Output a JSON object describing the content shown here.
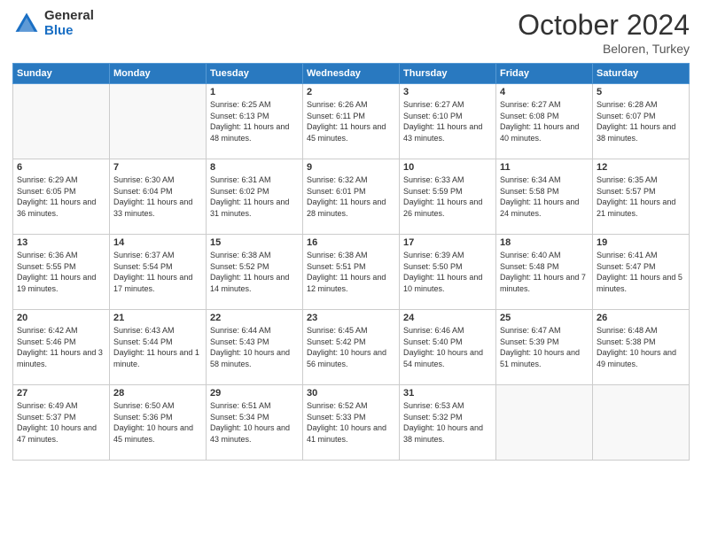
{
  "header": {
    "logo_general": "General",
    "logo_blue": "Blue",
    "month_title": "October 2024",
    "subtitle": "Beloren, Turkey"
  },
  "weekdays": [
    "Sunday",
    "Monday",
    "Tuesday",
    "Wednesday",
    "Thursday",
    "Friday",
    "Saturday"
  ],
  "weeks": [
    [
      {
        "day": "",
        "sunrise": "",
        "sunset": "",
        "daylight": ""
      },
      {
        "day": "",
        "sunrise": "",
        "sunset": "",
        "daylight": ""
      },
      {
        "day": "1",
        "sunrise": "Sunrise: 6:25 AM",
        "sunset": "Sunset: 6:13 PM",
        "daylight": "Daylight: 11 hours and 48 minutes."
      },
      {
        "day": "2",
        "sunrise": "Sunrise: 6:26 AM",
        "sunset": "Sunset: 6:11 PM",
        "daylight": "Daylight: 11 hours and 45 minutes."
      },
      {
        "day": "3",
        "sunrise": "Sunrise: 6:27 AM",
        "sunset": "Sunset: 6:10 PM",
        "daylight": "Daylight: 11 hours and 43 minutes."
      },
      {
        "day": "4",
        "sunrise": "Sunrise: 6:27 AM",
        "sunset": "Sunset: 6:08 PM",
        "daylight": "Daylight: 11 hours and 40 minutes."
      },
      {
        "day": "5",
        "sunrise": "Sunrise: 6:28 AM",
        "sunset": "Sunset: 6:07 PM",
        "daylight": "Daylight: 11 hours and 38 minutes."
      }
    ],
    [
      {
        "day": "6",
        "sunrise": "Sunrise: 6:29 AM",
        "sunset": "Sunset: 6:05 PM",
        "daylight": "Daylight: 11 hours and 36 minutes."
      },
      {
        "day": "7",
        "sunrise": "Sunrise: 6:30 AM",
        "sunset": "Sunset: 6:04 PM",
        "daylight": "Daylight: 11 hours and 33 minutes."
      },
      {
        "day": "8",
        "sunrise": "Sunrise: 6:31 AM",
        "sunset": "Sunset: 6:02 PM",
        "daylight": "Daylight: 11 hours and 31 minutes."
      },
      {
        "day": "9",
        "sunrise": "Sunrise: 6:32 AM",
        "sunset": "Sunset: 6:01 PM",
        "daylight": "Daylight: 11 hours and 28 minutes."
      },
      {
        "day": "10",
        "sunrise": "Sunrise: 6:33 AM",
        "sunset": "Sunset: 5:59 PM",
        "daylight": "Daylight: 11 hours and 26 minutes."
      },
      {
        "day": "11",
        "sunrise": "Sunrise: 6:34 AM",
        "sunset": "Sunset: 5:58 PM",
        "daylight": "Daylight: 11 hours and 24 minutes."
      },
      {
        "day": "12",
        "sunrise": "Sunrise: 6:35 AM",
        "sunset": "Sunset: 5:57 PM",
        "daylight": "Daylight: 11 hours and 21 minutes."
      }
    ],
    [
      {
        "day": "13",
        "sunrise": "Sunrise: 6:36 AM",
        "sunset": "Sunset: 5:55 PM",
        "daylight": "Daylight: 11 hours and 19 minutes."
      },
      {
        "day": "14",
        "sunrise": "Sunrise: 6:37 AM",
        "sunset": "Sunset: 5:54 PM",
        "daylight": "Daylight: 11 hours and 17 minutes."
      },
      {
        "day": "15",
        "sunrise": "Sunrise: 6:38 AM",
        "sunset": "Sunset: 5:52 PM",
        "daylight": "Daylight: 11 hours and 14 minutes."
      },
      {
        "day": "16",
        "sunrise": "Sunrise: 6:38 AM",
        "sunset": "Sunset: 5:51 PM",
        "daylight": "Daylight: 11 hours and 12 minutes."
      },
      {
        "day": "17",
        "sunrise": "Sunrise: 6:39 AM",
        "sunset": "Sunset: 5:50 PM",
        "daylight": "Daylight: 11 hours and 10 minutes."
      },
      {
        "day": "18",
        "sunrise": "Sunrise: 6:40 AM",
        "sunset": "Sunset: 5:48 PM",
        "daylight": "Daylight: 11 hours and 7 minutes."
      },
      {
        "day": "19",
        "sunrise": "Sunrise: 6:41 AM",
        "sunset": "Sunset: 5:47 PM",
        "daylight": "Daylight: 11 hours and 5 minutes."
      }
    ],
    [
      {
        "day": "20",
        "sunrise": "Sunrise: 6:42 AM",
        "sunset": "Sunset: 5:46 PM",
        "daylight": "Daylight: 11 hours and 3 minutes."
      },
      {
        "day": "21",
        "sunrise": "Sunrise: 6:43 AM",
        "sunset": "Sunset: 5:44 PM",
        "daylight": "Daylight: 11 hours and 1 minute."
      },
      {
        "day": "22",
        "sunrise": "Sunrise: 6:44 AM",
        "sunset": "Sunset: 5:43 PM",
        "daylight": "Daylight: 10 hours and 58 minutes."
      },
      {
        "day": "23",
        "sunrise": "Sunrise: 6:45 AM",
        "sunset": "Sunset: 5:42 PM",
        "daylight": "Daylight: 10 hours and 56 minutes."
      },
      {
        "day": "24",
        "sunrise": "Sunrise: 6:46 AM",
        "sunset": "Sunset: 5:40 PM",
        "daylight": "Daylight: 10 hours and 54 minutes."
      },
      {
        "day": "25",
        "sunrise": "Sunrise: 6:47 AM",
        "sunset": "Sunset: 5:39 PM",
        "daylight": "Daylight: 10 hours and 51 minutes."
      },
      {
        "day": "26",
        "sunrise": "Sunrise: 6:48 AM",
        "sunset": "Sunset: 5:38 PM",
        "daylight": "Daylight: 10 hours and 49 minutes."
      }
    ],
    [
      {
        "day": "27",
        "sunrise": "Sunrise: 6:49 AM",
        "sunset": "Sunset: 5:37 PM",
        "daylight": "Daylight: 10 hours and 47 minutes."
      },
      {
        "day": "28",
        "sunrise": "Sunrise: 6:50 AM",
        "sunset": "Sunset: 5:36 PM",
        "daylight": "Daylight: 10 hours and 45 minutes."
      },
      {
        "day": "29",
        "sunrise": "Sunrise: 6:51 AM",
        "sunset": "Sunset: 5:34 PM",
        "daylight": "Daylight: 10 hours and 43 minutes."
      },
      {
        "day": "30",
        "sunrise": "Sunrise: 6:52 AM",
        "sunset": "Sunset: 5:33 PM",
        "daylight": "Daylight: 10 hours and 41 minutes."
      },
      {
        "day": "31",
        "sunrise": "Sunrise: 6:53 AM",
        "sunset": "Sunset: 5:32 PM",
        "daylight": "Daylight: 10 hours and 38 minutes."
      },
      {
        "day": "",
        "sunrise": "",
        "sunset": "",
        "daylight": ""
      },
      {
        "day": "",
        "sunrise": "",
        "sunset": "",
        "daylight": ""
      }
    ]
  ]
}
